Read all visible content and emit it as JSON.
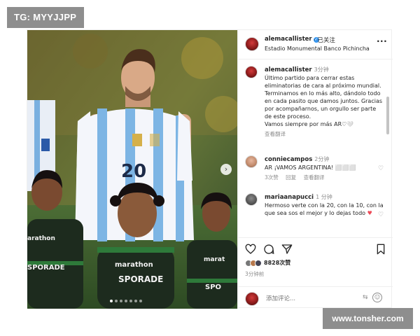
{
  "watermarks": {
    "top_left": "TG: MYYJJPP",
    "bottom_right": "www.tonsher.com"
  },
  "post": {
    "username": "alemacallister",
    "follow_label": "已关注",
    "location": "Estadio Monumental Banco Pichincha",
    "more_label": "···",
    "photo": {
      "jersey_number": "20",
      "shirt_sponsor": "marathon",
      "shirt_text": "SPORADE",
      "next_label": "›",
      "slide_count": 7,
      "active_slide": 1
    }
  },
  "comments": [
    {
      "username": "alemacallister",
      "time": "3分钟",
      "text": "Último partido para cerrar estas eliminatorias de cara al próximo mundial. Terminamos en lo más alto, dándolo todo en cada pasito que damos juntos. Gracias por acompañarnos, un orgullo ser parte de este proceso.\nVamos siempre por más AR♡🤍",
      "translate": "查看翻译"
    },
    {
      "username": "conniecampos",
      "time": "2分钟",
      "text": "AR ¡VAMOS ARGENTINA! ⬜⬜⬜",
      "likes": "3次赞",
      "reply": "回复",
      "translate": "查看翻译"
    },
    {
      "username": "mariaanapucci",
      "time": "1 分钟",
      "text": "Hermoso verte con la 20, con la 10, con la que sea sos el mejor y lo dejas todo",
      "heart": "♥"
    }
  ],
  "actions": {
    "likes_count": "8828次赞",
    "posted_ago": "3分钟前"
  },
  "comment_box": {
    "placeholder": "添加评论...",
    "gif_label": "⇆",
    "emoji_label": "☺"
  },
  "colors": {
    "accent": "#3897f0",
    "heart": "#ed4956",
    "muted": "#8e8e8e"
  }
}
